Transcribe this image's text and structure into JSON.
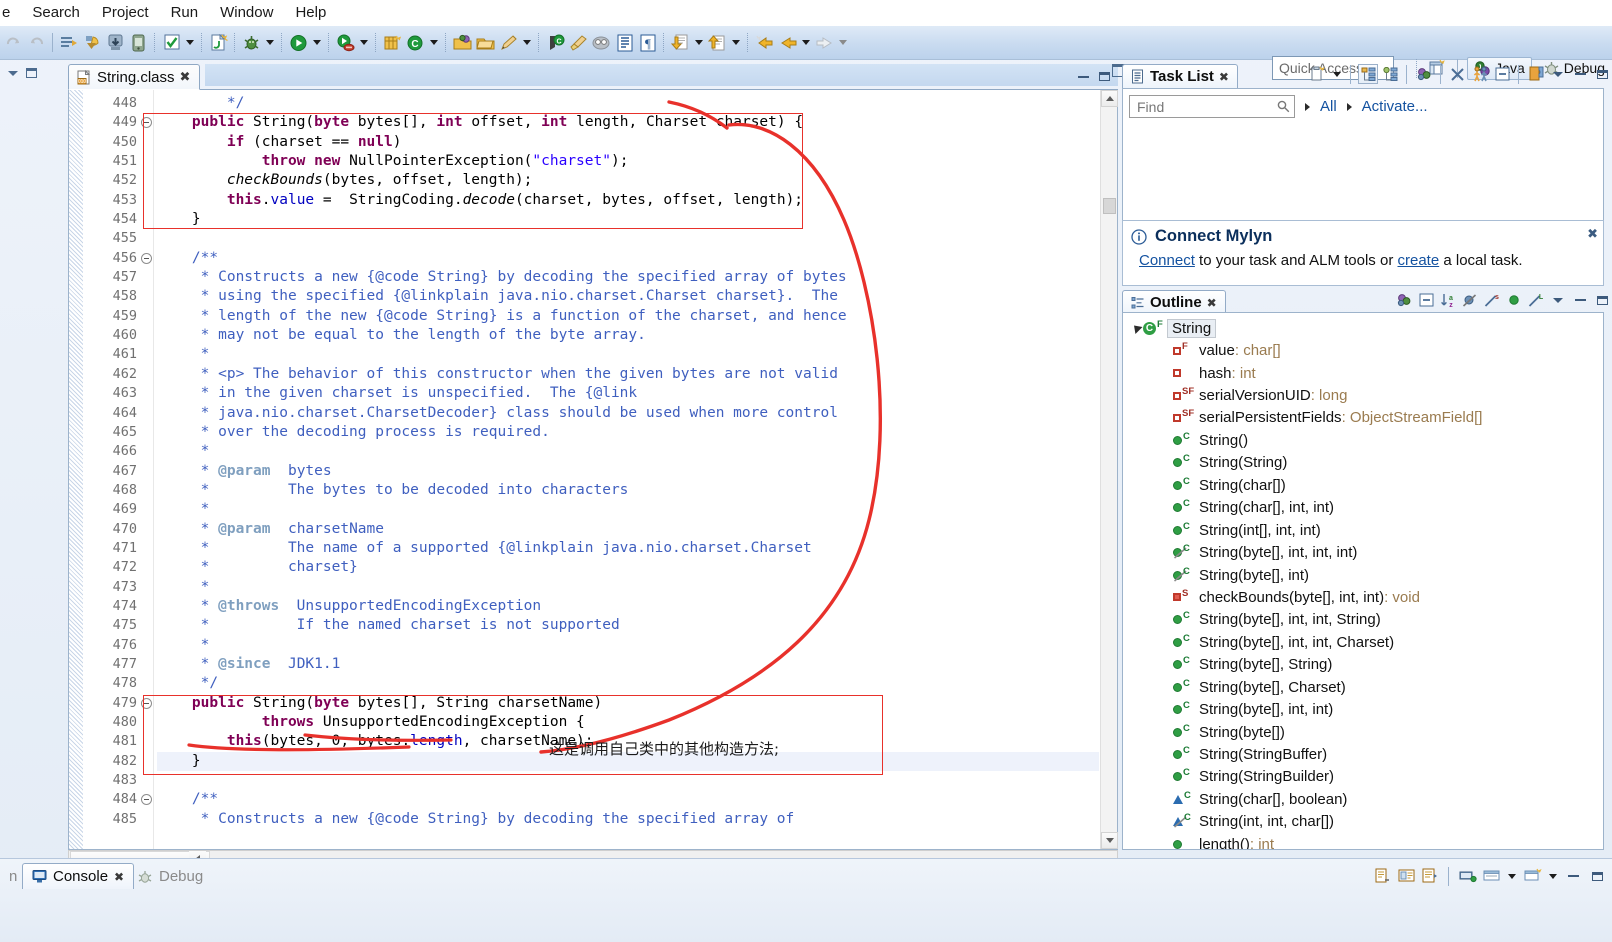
{
  "menubar": {
    "items": [
      {
        "label": "e",
        "name": "menu-file-clipped"
      },
      {
        "label": "Search",
        "name": "menu-search"
      },
      {
        "label": "Project",
        "name": "menu-project"
      },
      {
        "label": "Run",
        "name": "menu-run"
      },
      {
        "label": "Window",
        "name": "menu-window"
      },
      {
        "label": "Help",
        "name": "menu-help"
      }
    ]
  },
  "toolbar": {
    "quick_access_placeholder": "Quick Access",
    "perspective_java": "Java",
    "perspective_debug": "Debug"
  },
  "editor": {
    "tab_label": "String.class",
    "first_line_number": 448,
    "lines": [
      {
        "num": "448",
        "fold": false,
        "segments": [
          {
            "t": "        ",
            "c": "plain"
          },
          {
            "t": "*/",
            "c": "cmt"
          }
        ]
      },
      {
        "num": "449",
        "fold": true,
        "segments": [
          {
            "t": "    ",
            "c": "plain"
          },
          {
            "t": "public",
            "c": "kw"
          },
          {
            "t": " String(",
            "c": "plain"
          },
          {
            "t": "byte",
            "c": "kw"
          },
          {
            "t": " bytes[], ",
            "c": "plain"
          },
          {
            "t": "int",
            "c": "kw"
          },
          {
            "t": " offset, ",
            "c": "plain"
          },
          {
            "t": "int",
            "c": "kw"
          },
          {
            "t": " length, Charset charset) {",
            "c": "plain"
          }
        ]
      },
      {
        "num": "450",
        "fold": false,
        "segments": [
          {
            "t": "        ",
            "c": "plain"
          },
          {
            "t": "if",
            "c": "kw"
          },
          {
            "t": " (charset == ",
            "c": "plain"
          },
          {
            "t": "null",
            "c": "kw"
          },
          {
            "t": ")",
            "c": "plain"
          }
        ]
      },
      {
        "num": "451",
        "fold": false,
        "segments": [
          {
            "t": "            ",
            "c": "plain"
          },
          {
            "t": "throw new",
            "c": "kw"
          },
          {
            "t": " NullPointerException(",
            "c": "plain"
          },
          {
            "t": "\"charset\"",
            "c": "str"
          },
          {
            "t": ");",
            "c": "plain"
          }
        ]
      },
      {
        "num": "452",
        "fold": false,
        "segments": [
          {
            "t": "        ",
            "c": "plain"
          },
          {
            "t": "checkBounds",
            "c": "it"
          },
          {
            "t": "(bytes, offset, length);",
            "c": "plain"
          }
        ]
      },
      {
        "num": "453",
        "fold": false,
        "segments": [
          {
            "t": "        ",
            "c": "plain"
          },
          {
            "t": "this",
            "c": "kw"
          },
          {
            "t": ".",
            "c": "plain"
          },
          {
            "t": "value",
            "c": "fld"
          },
          {
            "t": " =  StringCoding.",
            "c": "plain"
          },
          {
            "t": "decode",
            "c": "it"
          },
          {
            "t": "(charset, bytes, offset, length);",
            "c": "plain"
          }
        ]
      },
      {
        "num": "454",
        "fold": false,
        "segments": [
          {
            "t": "    }",
            "c": "plain"
          }
        ]
      },
      {
        "num": "455",
        "fold": false,
        "segments": [
          {
            "t": "",
            "c": "plain"
          }
        ]
      },
      {
        "num": "456",
        "fold": true,
        "segments": [
          {
            "t": "    /**",
            "c": "cmt"
          }
        ]
      },
      {
        "num": "457",
        "fold": false,
        "segments": [
          {
            "t": "     * Constructs a new {@code String} by decoding the specified array of bytes",
            "c": "cmt"
          }
        ]
      },
      {
        "num": "458",
        "fold": false,
        "segments": [
          {
            "t": "     * using the specified {@linkplain java.nio.charset.Charset charset}.  The",
            "c": "cmt"
          }
        ]
      },
      {
        "num": "459",
        "fold": false,
        "segments": [
          {
            "t": "     * length of the new {@code String} is a function of the charset, and hence",
            "c": "cmt"
          }
        ]
      },
      {
        "num": "460",
        "fold": false,
        "segments": [
          {
            "t": "     * may not be equal to the length of the byte array.",
            "c": "cmt"
          }
        ]
      },
      {
        "num": "461",
        "fold": false,
        "segments": [
          {
            "t": "     *",
            "c": "cmt"
          }
        ]
      },
      {
        "num": "462",
        "fold": false,
        "segments": [
          {
            "t": "     * <p> The behavior of this constructor when the given bytes are not valid",
            "c": "cmt"
          }
        ]
      },
      {
        "num": "463",
        "fold": false,
        "segments": [
          {
            "t": "     * in the given charset is unspecified.  The {@link",
            "c": "cmt"
          }
        ]
      },
      {
        "num": "464",
        "fold": false,
        "segments": [
          {
            "t": "     * java.nio.charset.CharsetDecoder} class should be used when more control",
            "c": "cmt"
          }
        ]
      },
      {
        "num": "465",
        "fold": false,
        "segments": [
          {
            "t": "     * over the decoding process is required.",
            "c": "cmt"
          }
        ]
      },
      {
        "num": "466",
        "fold": false,
        "segments": [
          {
            "t": "     *",
            "c": "cmt"
          }
        ]
      },
      {
        "num": "467",
        "fold": false,
        "segments": [
          {
            "t": "     * ",
            "c": "cmt"
          },
          {
            "t": "@param",
            "c": "tag"
          },
          {
            "t": "  bytes",
            "c": "cmt"
          }
        ]
      },
      {
        "num": "468",
        "fold": false,
        "segments": [
          {
            "t": "     *         The bytes to be decoded into characters",
            "c": "cmt"
          }
        ]
      },
      {
        "num": "469",
        "fold": false,
        "segments": [
          {
            "t": "     *",
            "c": "cmt"
          }
        ]
      },
      {
        "num": "470",
        "fold": false,
        "segments": [
          {
            "t": "     * ",
            "c": "cmt"
          },
          {
            "t": "@param",
            "c": "tag"
          },
          {
            "t": "  charsetName",
            "c": "cmt"
          }
        ]
      },
      {
        "num": "471",
        "fold": false,
        "segments": [
          {
            "t": "     *         The name of a supported {@linkplain java.nio.charset.Charset",
            "c": "cmt"
          }
        ]
      },
      {
        "num": "472",
        "fold": false,
        "segments": [
          {
            "t": "     *         charset}",
            "c": "cmt"
          }
        ]
      },
      {
        "num": "473",
        "fold": false,
        "segments": [
          {
            "t": "     *",
            "c": "cmt"
          }
        ]
      },
      {
        "num": "474",
        "fold": false,
        "segments": [
          {
            "t": "     * ",
            "c": "cmt"
          },
          {
            "t": "@throws",
            "c": "tag"
          },
          {
            "t": "  UnsupportedEncodingException",
            "c": "cmt"
          }
        ]
      },
      {
        "num": "475",
        "fold": false,
        "segments": [
          {
            "t": "     *          If the named charset is not supported",
            "c": "cmt"
          }
        ]
      },
      {
        "num": "476",
        "fold": false,
        "segments": [
          {
            "t": "     *",
            "c": "cmt"
          }
        ]
      },
      {
        "num": "477",
        "fold": false,
        "segments": [
          {
            "t": "     * ",
            "c": "cmt"
          },
          {
            "t": "@since",
            "c": "tag"
          },
          {
            "t": "  JDK1.1",
            "c": "cmt"
          }
        ]
      },
      {
        "num": "478",
        "fold": false,
        "segments": [
          {
            "t": "     */",
            "c": "cmt"
          }
        ]
      },
      {
        "num": "479",
        "fold": true,
        "segments": [
          {
            "t": "    ",
            "c": "plain"
          },
          {
            "t": "public",
            "c": "kw"
          },
          {
            "t": " String(",
            "c": "plain"
          },
          {
            "t": "byte",
            "c": "kw"
          },
          {
            "t": " bytes[], String charsetName)",
            "c": "plain"
          }
        ]
      },
      {
        "num": "480",
        "fold": false,
        "segments": [
          {
            "t": "            ",
            "c": "plain"
          },
          {
            "t": "throws",
            "c": "kw"
          },
          {
            "t": " UnsupportedEncodingException {",
            "c": "plain"
          }
        ]
      },
      {
        "num": "481",
        "fold": false,
        "segments": [
          {
            "t": "        ",
            "c": "plain"
          },
          {
            "t": "this",
            "c": "kw"
          },
          {
            "t": "(bytes, 0, bytes.",
            "c": "plain"
          },
          {
            "t": "length",
            "c": "fld"
          },
          {
            "t": ", charsetName);",
            "c": "plain"
          }
        ]
      },
      {
        "num": "482",
        "fold": false,
        "hl": true,
        "segments": [
          {
            "t": "    }",
            "c": "plain"
          }
        ]
      },
      {
        "num": "483",
        "fold": false,
        "segments": [
          {
            "t": "",
            "c": "plain"
          }
        ]
      },
      {
        "num": "484",
        "fold": true,
        "segments": [
          {
            "t": "    /**",
            "c": "cmt"
          }
        ]
      },
      {
        "num": "485",
        "fold": false,
        "segments": [
          {
            "t": "     * Constructs a new {@code String} by decoding the specified array of",
            "c": "cmt"
          }
        ]
      }
    ],
    "annotation_text": "这是调用自己类中的其他构造方法;"
  },
  "task_list": {
    "tab_label": "Task List",
    "find_placeholder": "Find",
    "filter_all": "All",
    "filter_activate": "Activate..."
  },
  "mylyn": {
    "title": "Connect Mylyn",
    "body_prefix": "",
    "link_connect": "Connect",
    "body_middle": " to your task and ALM tools or ",
    "link_create": "create",
    "body_suffix": " a local task."
  },
  "outline": {
    "tab_label": "Outline",
    "items": [
      {
        "label": "String",
        "type": "",
        "icon": "class-icon",
        "mod": "F",
        "modcolor": "green",
        "indent": 0,
        "selected": true,
        "expander": true
      },
      {
        "label": "value",
        "type": " : char[]",
        "icon": "field-private-icon",
        "mod": "F",
        "modcolor": "red",
        "indent": 1
      },
      {
        "label": "hash",
        "type": " : int",
        "icon": "field-private-icon",
        "mod": "",
        "modcolor": "red",
        "indent": 1
      },
      {
        "label": "serialVersionUID",
        "type": " : long",
        "icon": "field-private-icon",
        "mod": "SF",
        "modcolor": "red",
        "indent": 1
      },
      {
        "label": "serialPersistentFields",
        "type": " : ObjectStreamField[]",
        "icon": "field-private-icon",
        "mod": "SF",
        "modcolor": "red",
        "indent": 1
      },
      {
        "label": "String()",
        "type": "",
        "icon": "method-public-icon",
        "mod": "C",
        "modcolor": "green",
        "indent": 1
      },
      {
        "label": "String(String)",
        "type": "",
        "icon": "method-public-icon",
        "mod": "C",
        "modcolor": "green",
        "indent": 1
      },
      {
        "label": "String(char[])",
        "type": "",
        "icon": "method-public-icon",
        "mod": "C",
        "modcolor": "green",
        "indent": 1
      },
      {
        "label": "String(char[], int, int)",
        "type": "",
        "icon": "method-public-icon",
        "mod": "C",
        "modcolor": "green",
        "indent": 1
      },
      {
        "label": "String(int[], int, int)",
        "type": "",
        "icon": "method-public-icon",
        "mod": "C",
        "modcolor": "green",
        "indent": 1
      },
      {
        "label": "String(byte[], int, int, int)",
        "type": "",
        "icon": "method-public-deprecated-icon",
        "mod": "C",
        "modcolor": "green",
        "indent": 1,
        "deprecated": true
      },
      {
        "label": "String(byte[], int)",
        "type": "",
        "icon": "method-public-deprecated-icon",
        "mod": "C",
        "modcolor": "green",
        "indent": 1,
        "deprecated": true
      },
      {
        "label": "checkBounds(byte[], int, int)",
        "type": " : void",
        "icon": "method-private-static-icon",
        "mod": "S",
        "modcolor": "red",
        "indent": 1
      },
      {
        "label": "String(byte[], int, int, String)",
        "type": "",
        "icon": "method-public-icon",
        "mod": "C",
        "modcolor": "green",
        "indent": 1
      },
      {
        "label": "String(byte[], int, int, Charset)",
        "type": "",
        "icon": "method-public-icon",
        "mod": "C",
        "modcolor": "green",
        "indent": 1
      },
      {
        "label": "String(byte[], String)",
        "type": "",
        "icon": "method-public-icon",
        "mod": "C",
        "modcolor": "green",
        "indent": 1
      },
      {
        "label": "String(byte[], Charset)",
        "type": "",
        "icon": "method-public-icon",
        "mod": "C",
        "modcolor": "green",
        "indent": 1
      },
      {
        "label": "String(byte[], int, int)",
        "type": "",
        "icon": "method-public-icon",
        "mod": "C",
        "modcolor": "green",
        "indent": 1
      },
      {
        "label": "String(byte[])",
        "type": "",
        "icon": "method-public-icon",
        "mod": "C",
        "modcolor": "green",
        "indent": 1
      },
      {
        "label": "String(StringBuffer)",
        "type": "",
        "icon": "method-public-icon",
        "mod": "C",
        "modcolor": "green",
        "indent": 1
      },
      {
        "label": "String(StringBuilder)",
        "type": "",
        "icon": "method-public-icon",
        "mod": "C",
        "modcolor": "green",
        "indent": 1
      },
      {
        "label": "String(char[], boolean)",
        "type": "",
        "icon": "method-package-icon",
        "mod": "C",
        "modcolor": "green",
        "indent": 1
      },
      {
        "label": "String(int, int, char[])",
        "type": "",
        "icon": "method-package-deprecated-icon",
        "mod": "C",
        "modcolor": "green",
        "indent": 1,
        "deprecated": true
      },
      {
        "label": "length()",
        "type": " : int",
        "icon": "method-public-icon",
        "mod": "",
        "modcolor": "green",
        "indent": 1
      }
    ]
  },
  "bottom": {
    "tab_partial": "n",
    "tab_console": "Console",
    "tab_debug": "Debug"
  },
  "colors": {
    "accent_blue": "#1452a0",
    "annotation_red": "#e8312b",
    "keyword_purple": "#7f0055",
    "comment_blue": "#3f5fbf",
    "string_blue": "#2a00ff",
    "toolbar_bg": "#c9dbf0"
  }
}
